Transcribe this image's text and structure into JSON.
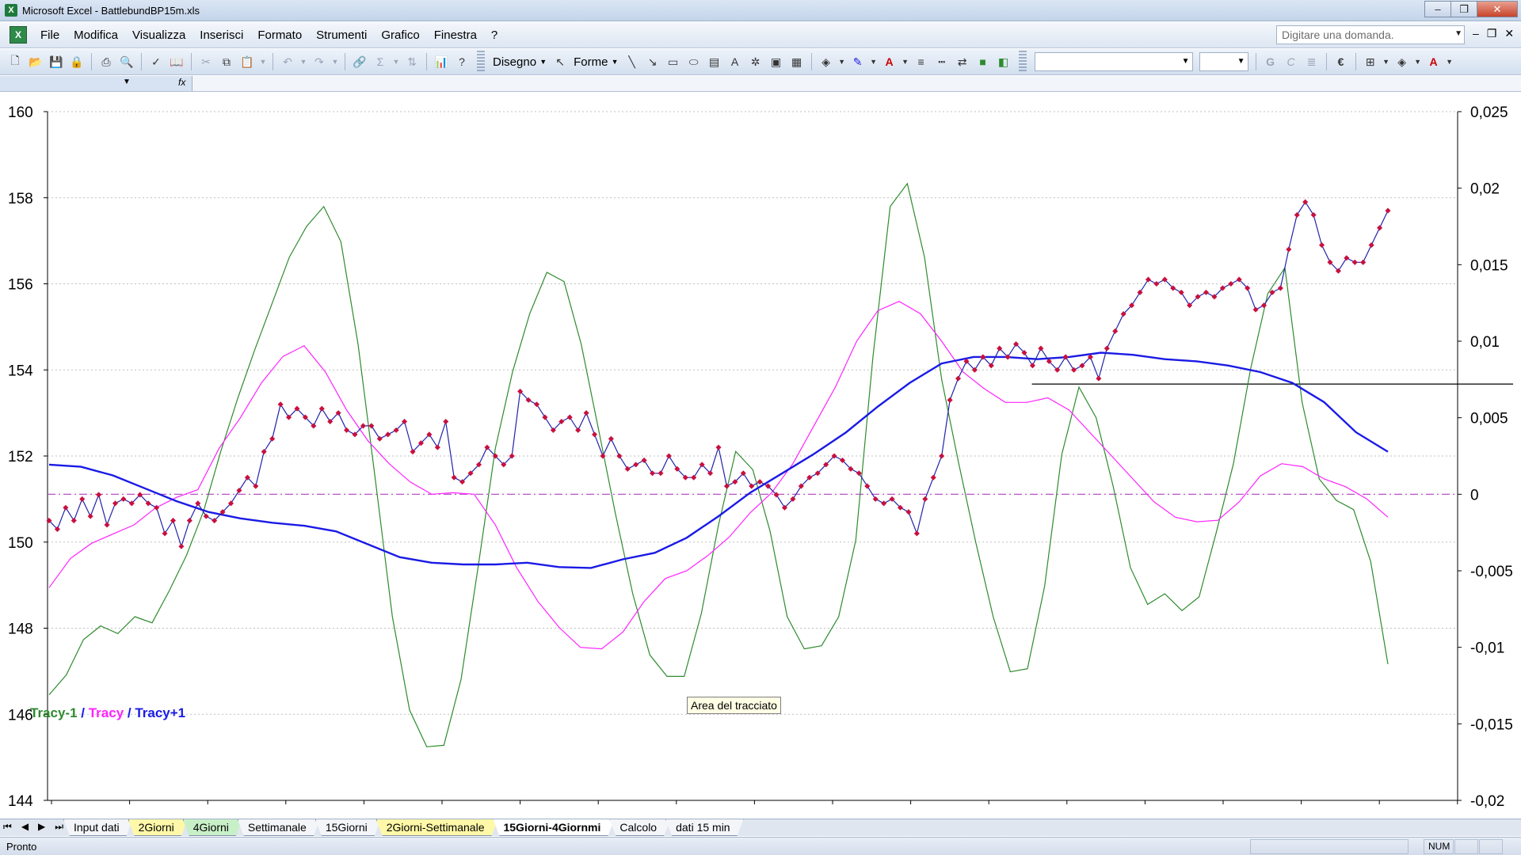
{
  "window": {
    "title": "Microsoft Excel - BattlebundBP15m.xls",
    "app_icon": "excel-icon"
  },
  "menu": {
    "items": [
      "File",
      "Modifica",
      "Visualizza",
      "Inserisci",
      "Formato",
      "Strumenti",
      "Grafico",
      "Finestra",
      "?"
    ],
    "ask_placeholder": "Digitare una domanda."
  },
  "toolbar": {
    "draw_label": "Disegno",
    "shapes_label": "Forme",
    "bold": "G",
    "italic": "C",
    "euro": "€"
  },
  "chart_data": {
    "type": "line",
    "y_left": {
      "min": 144,
      "max": 160,
      "ticks": [
        "160",
        "158",
        "156",
        "154",
        "152",
        "150",
        "148",
        "146",
        "144"
      ]
    },
    "y_right": {
      "min": -0.02,
      "max": 0.025,
      "ticks": [
        "0,025",
        "0,02",
        "0,015",
        "0,01",
        "0,005",
        "0",
        "-0,005",
        "-0,01",
        "-0,015",
        "-0,02"
      ]
    },
    "horizontal_lines": [
      {
        "axis": "right",
        "value": 0,
        "style": "dash-dot",
        "color": "#b040c0"
      },
      {
        "axis": "right",
        "value": 0.0072,
        "style": "solid",
        "color": "#000000",
        "x_start": 0.67,
        "x_end": 1.0
      }
    ],
    "series": [
      {
        "legend": "Tracy-1",
        "axis": "right",
        "color": "#2e8b2e",
        "values": [
          -0.0131,
          -0.0118,
          -0.0095,
          -0.0086,
          -0.0091,
          -0.008,
          -0.0084,
          -0.0063,
          -0.004,
          -0.0011,
          0.0028,
          0.0063,
          0.0095,
          0.0125,
          0.0155,
          0.0175,
          0.0188,
          0.0165,
          0.0098,
          0.001,
          -0.008,
          -0.0141,
          -0.0165,
          -0.0164,
          -0.0121,
          -0.0047,
          0.003,
          0.008,
          0.0118,
          0.0145,
          0.0139,
          0.0098,
          0.0043,
          -0.0013,
          -0.0065,
          -0.0105,
          -0.0119,
          -0.0119,
          -0.0078,
          -0.002,
          0.0028,
          0.0016,
          -0.0024,
          -0.008,
          -0.0101,
          -0.0099,
          -0.008,
          -0.003,
          0.009,
          0.0188,
          0.0203,
          0.0155,
          0.0075,
          0.002,
          -0.0032,
          -0.008,
          -0.0116,
          -0.0114,
          -0.006,
          0.0026,
          0.007,
          0.005,
          0.0005,
          -0.0048,
          -0.0072,
          -0.0065,
          -0.0076,
          -0.0067,
          -0.0025,
          0.002,
          0.0082,
          0.0131,
          0.0148,
          0.006,
          0.001,
          -0.0004,
          -0.001,
          -0.0044,
          -0.0111
        ]
      },
      {
        "legend": "Tracy",
        "axis": "right",
        "color": "#ff22ff",
        "values": [
          -0.0061,
          -0.0042,
          -0.0032,
          -0.0026,
          -0.002,
          -0.0009,
          -0.0002,
          0.0003,
          0.003,
          0.005,
          0.0073,
          0.009,
          0.0097,
          0.008,
          0.0055,
          0.0035,
          0.002,
          0.0008,
          0.0,
          0.0001,
          0.0,
          -0.002,
          -0.0048,
          -0.007,
          -0.0087,
          -0.01,
          -0.0101,
          -0.009,
          -0.007,
          -0.0055,
          -0.005,
          -0.004,
          -0.0028,
          -0.0012,
          0.0001,
          0.002,
          0.0045,
          0.007,
          0.01,
          0.012,
          0.0126,
          0.0118,
          0.01,
          0.008,
          0.0069,
          0.006,
          0.006,
          0.0063,
          0.0055,
          0.004,
          0.0025,
          0.001,
          -0.0005,
          -0.0015,
          -0.0018,
          -0.0017,
          -0.0005,
          0.0012,
          0.002,
          0.0018,
          0.001,
          0.0005,
          -0.0003,
          -0.0015
        ]
      },
      {
        "legend": "Tracy+1",
        "axis": "left",
        "color": "#1a1ae6",
        "values": [
          151.8,
          151.75,
          151.55,
          151.25,
          150.95,
          150.7,
          150.55,
          150.45,
          150.38,
          150.25,
          149.95,
          149.65,
          149.52,
          149.48,
          149.48,
          149.52,
          149.42,
          149.4,
          149.6,
          149.75,
          150.1,
          150.6,
          151.15,
          151.6,
          152.05,
          152.55,
          153.15,
          153.7,
          154.15,
          154.3,
          154.3,
          154.25,
          154.3,
          154.4,
          154.35,
          154.25,
          154.2,
          154.1,
          153.95,
          153.7,
          153.25,
          152.55,
          152.1
        ]
      },
      {
        "legend": "",
        "axis": "left",
        "color": "#2222aa",
        "marker": "#c8103e",
        "values": [
          150.5,
          150.3,
          150.8,
          150.5,
          151.0,
          150.6,
          151.1,
          150.4,
          150.9,
          151.0,
          150.9,
          151.1,
          150.9,
          150.8,
          150.2,
          150.5,
          149.9,
          150.5,
          150.9,
          150.6,
          150.5,
          150.7,
          150.9,
          151.2,
          151.5,
          151.3,
          152.1,
          152.4,
          153.2,
          152.9,
          153.1,
          152.9,
          152.7,
          153.1,
          152.8,
          153.0,
          152.6,
          152.5,
          152.7,
          152.7,
          152.4,
          152.5,
          152.6,
          152.8,
          152.1,
          152.3,
          152.5,
          152.2,
          152.8,
          151.5,
          151.4,
          151.6,
          151.8,
          152.2,
          152.0,
          151.8,
          152.0,
          153.5,
          153.3,
          153.2,
          152.9,
          152.6,
          152.8,
          152.9,
          152.6,
          153.0,
          152.5,
          152.0,
          152.4,
          152.0,
          151.7,
          151.8,
          151.9,
          151.6,
          151.6,
          152.0,
          151.7,
          151.5,
          151.5,
          151.8,
          151.6,
          152.2,
          151.3,
          151.4,
          151.6,
          151.3,
          151.4,
          151.3,
          151.1,
          150.8,
          151.0,
          151.3,
          151.5,
          151.6,
          151.8,
          152.0,
          151.9,
          151.7,
          151.6,
          151.3,
          151.0,
          150.9,
          151.0,
          150.8,
          150.7,
          150.2,
          151.0,
          151.5,
          152.0,
          153.3,
          153.8,
          154.2,
          154.0,
          154.3,
          154.1,
          154.5,
          154.3,
          154.6,
          154.4,
          154.1,
          154.5,
          154.2,
          154.0,
          154.3,
          154.0,
          154.1,
          154.3,
          153.8,
          154.5,
          154.9,
          155.3,
          155.5,
          155.8,
          156.1,
          156.0,
          156.1,
          155.9,
          155.8,
          155.5,
          155.7,
          155.8,
          155.7,
          155.9,
          156.0,
          156.1,
          155.9,
          155.4,
          155.5,
          155.8,
          155.9,
          156.8,
          157.6,
          157.9,
          157.6,
          156.9,
          156.5,
          156.3,
          156.6,
          156.5,
          156.5,
          156.9,
          157.3,
          157.7
        ]
      }
    ]
  },
  "legend": {
    "g": "Tracy-1",
    "sep1": " / ",
    "m": "Tracy",
    "sep2": " / ",
    "b": "Tracy+1"
  },
  "tooltip": "Area del tracciato",
  "sheet_tabs": [
    {
      "label": "Input dati",
      "color": "#f3f5f8"
    },
    {
      "label": "2Giorni",
      "color": "#fff8a8"
    },
    {
      "label": "4Giorni",
      "color": "#c8f0c8"
    },
    {
      "label": "Settimanale",
      "color": "#f3f5f8"
    },
    {
      "label": "15Giorni",
      "color": "#f3f5f8"
    },
    {
      "label": "2Giorni-Settimanale",
      "color": "#fff8a8"
    },
    {
      "label": "15Giorni-4Giornmi",
      "color": "#ffffff",
      "active": true
    },
    {
      "label": "Calcolo",
      "color": "#f3f5f8"
    },
    {
      "label": "dati 15 min",
      "color": "#f3f5f8"
    }
  ],
  "status": {
    "ready": "Pronto",
    "num": "NUM"
  }
}
